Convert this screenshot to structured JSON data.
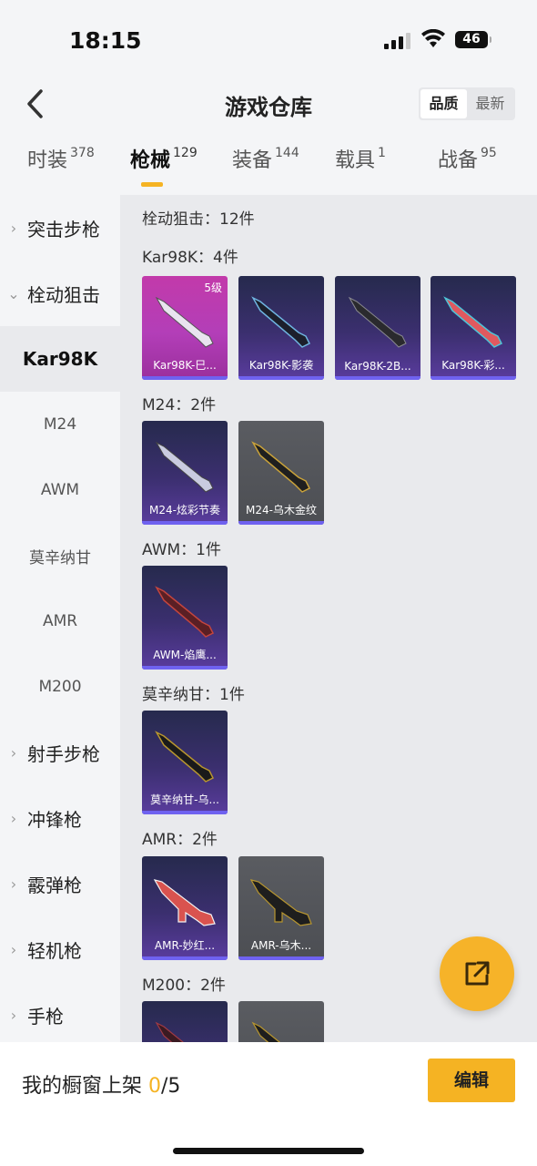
{
  "status": {
    "time": "18:15",
    "battery": "46"
  },
  "header": {
    "title": "游戏仓库",
    "sort_options": [
      "品质",
      "最新"
    ],
    "active_sort": "品质"
  },
  "tabs": [
    {
      "label": "时装",
      "count": "378"
    },
    {
      "label": "枪械",
      "count": "129"
    },
    {
      "label": "装备",
      "count": "144"
    },
    {
      "label": "载具",
      "count": "1"
    },
    {
      "label": "战备",
      "count": "95"
    }
  ],
  "sidebar": {
    "items": [
      {
        "label": "突击步枪"
      },
      {
        "label": "栓动狙击"
      },
      {
        "label": "Kar98K"
      },
      {
        "label": "M24"
      },
      {
        "label": "AWM"
      },
      {
        "label": "莫辛纳甘"
      },
      {
        "label": "AMR"
      },
      {
        "label": "M200"
      },
      {
        "label": "射手步枪"
      },
      {
        "label": "冲锋枪"
      },
      {
        "label": "霰弹枪"
      },
      {
        "label": "轻机枪"
      },
      {
        "label": "手枪"
      }
    ]
  },
  "content": {
    "category_title": "栓动狙击：12件",
    "sections": [
      {
        "title": "Kar98K：4件",
        "items": [
          {
            "name": "Kar98K-巳...",
            "level": "5级"
          },
          {
            "name": "Kar98K-影袭"
          },
          {
            "name": "Kar98K-2B..."
          },
          {
            "name": "Kar98K-彩..."
          }
        ]
      },
      {
        "title": "M24：2件",
        "items": [
          {
            "name": "M24-炫彩节奏"
          },
          {
            "name": "M24-乌木金纹"
          }
        ]
      },
      {
        "title": "AWM：1件",
        "items": [
          {
            "name": "AWM-焰鹰..."
          }
        ]
      },
      {
        "title": "莫辛纳甘：1件",
        "items": [
          {
            "name": "莫辛纳甘-乌..."
          }
        ]
      },
      {
        "title": "AMR：2件",
        "items": [
          {
            "name": "AMR-妙红..."
          },
          {
            "name": "AMR-乌木..."
          }
        ]
      },
      {
        "title": "M200：2件",
        "items": [
          {
            "name": ""
          },
          {
            "name": ""
          }
        ]
      }
    ]
  },
  "bottom": {
    "shelf_label": "我的橱窗上架 ",
    "shelf_current": "0",
    "shelf_total": "/5",
    "edit_label": "编辑"
  }
}
